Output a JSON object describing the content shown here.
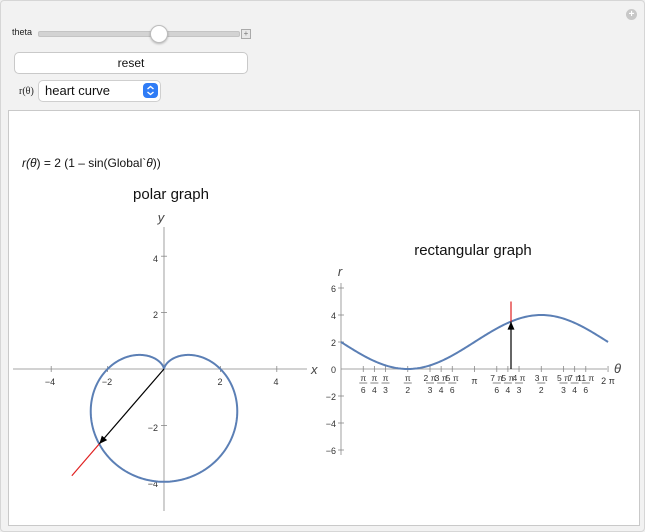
{
  "controls": {
    "theta_label": "theta",
    "theta_value": 0.6,
    "reset_label": "reset",
    "r_label": "r(θ)",
    "r_selected": "heart curve"
  },
  "formula": {
    "r_part": "r(",
    "theta_sym": "θ",
    "mid": ") = 2 (1 – sin(Global`",
    "theta_sym2": "θ",
    "end": "))"
  },
  "polar": {
    "title": "polar graph",
    "xlabel": "x",
    "ylabel": "y",
    "x_ticks": [
      "−4",
      "−2",
      "2",
      "4"
    ],
    "y_ticks": [
      "4",
      "2",
      "−2",
      "−4"
    ]
  },
  "rect": {
    "title": "rectangular graph",
    "xlabel": "θ",
    "ylabel": "r",
    "y_ticks": [
      "6",
      "4",
      "2",
      "0",
      "−2",
      "−4",
      "−6"
    ],
    "pi_label": "π",
    "two_pi_label": "2 π"
  },
  "colors": {
    "curve": "#5b7fb5",
    "indicator": "#e02020",
    "arrow": "#000000",
    "accent": "#2f7cf6"
  },
  "chart_data": [
    {
      "type": "line",
      "title": "polar graph",
      "xlabel": "x",
      "ylabel": "y",
      "xlim": [
        -5.5,
        5.2
      ],
      "ylim": [
        -5,
        5
      ],
      "function": "r(θ) = 2 (1 – sin(θ))",
      "current_theta": 4.0,
      "current_r": 3.51,
      "current_point": [
        -2.29,
        -2.66
      ]
    },
    {
      "type": "line",
      "title": "rectangular graph",
      "xlabel": "θ",
      "ylabel": "r",
      "xlim": [
        0,
        6.283
      ],
      "ylim": [
        -6,
        6
      ],
      "x_ticks": [
        "π/6",
        "π/4",
        "π/3",
        "π/2",
        "2π/3",
        "3π/4",
        "5π/6",
        "π",
        "7π/6",
        "5π/4",
        "4π/3",
        "3π/2",
        "5π/3",
        "7π/4",
        "11π/6",
        "2π"
      ],
      "current_theta": 4.0,
      "current_r": 3.51
    }
  ]
}
